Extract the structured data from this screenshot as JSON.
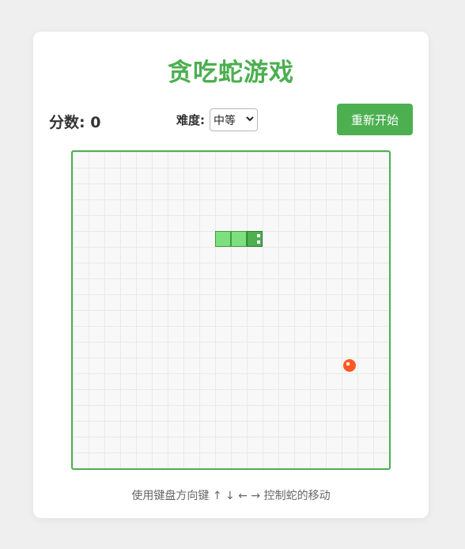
{
  "header": {
    "title": "贪吃蛇游戏"
  },
  "controls": {
    "score_label": "分数: 0",
    "difficulty_label": "难度:",
    "difficulty_selected": "中等",
    "restart_label": "重新开始"
  },
  "game": {
    "grid_cells": 20,
    "snake": [
      {
        "col": 11,
        "row": 5,
        "part": "head",
        "direction": "right"
      },
      {
        "col": 10,
        "row": 5,
        "part": "body"
      },
      {
        "col": 9,
        "row": 5,
        "part": "body"
      }
    ],
    "food": {
      "col": 17,
      "row": 13
    },
    "colors": {
      "accent": "#4caf50",
      "snake_body": "#7ddf7d",
      "snake_head": "#4caf50",
      "food": "#ff5722"
    }
  },
  "footer": {
    "hint": "使用键盘方向键 ↑ ↓ ← → 控制蛇的移动"
  }
}
